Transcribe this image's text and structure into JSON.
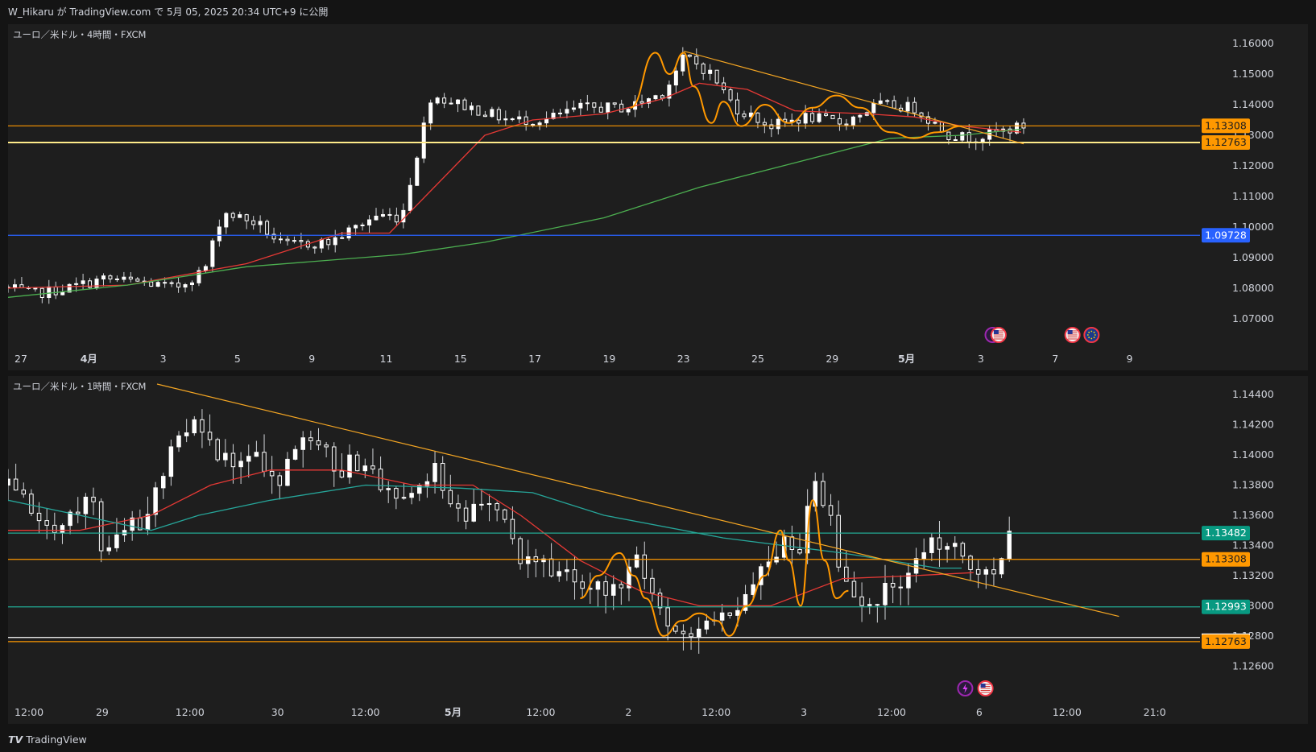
{
  "header": {
    "text": "W_Hikaru が TradingView.com で 5月 05, 2025 20:34 UTC+9 に公開"
  },
  "footer": {
    "brand": "TradingView"
  },
  "colors": {
    "bg": "#1e1e1e",
    "up": "#ffffff",
    "down": "#ffffff",
    "wick": "#cfd2d6",
    "ma_fast": "#e53935",
    "ma_slow": "#4caf50",
    "ma_teal": "#26a69a",
    "trend": "#f5a623",
    "zigzag": "#ff9800",
    "level_orange": "#ff9800",
    "level_yellow": "#ffeb8a",
    "level_blue": "#2962ff",
    "level_teal": "#22ab94",
    "label_orange": "#ff9800",
    "label_blue": "#2962ff",
    "label_teal": "#089981"
  },
  "chart_data": [
    {
      "type": "candlestick",
      "title": "ユーロ／米ドル・4時間・FXCM",
      "price_axis": {
        "ticks": [
          "1.16000",
          "1.15000",
          "1.14000",
          "1.13000",
          "1.12000",
          "1.11000",
          "1.10000",
          "1.09000",
          "1.08000",
          "1.07000"
        ],
        "ylim": [
          1.0647,
          1.1637
        ]
      },
      "time_axis": {
        "ticks": [
          "27",
          "4月",
          "3",
          "5",
          "9",
          "11",
          "15",
          "17",
          "19",
          "23",
          "25",
          "29",
          "5月",
          "3",
          "7",
          "9"
        ],
        "bold": [
          "4月",
          "5月"
        ]
      },
      "levels": [
        {
          "name": "level-1.13308",
          "value": 1.13308,
          "label": "1.13308",
          "color": "orange"
        },
        {
          "name": "level-1.12763",
          "value": 1.12763,
          "label": "1.12763",
          "color": "yellow"
        },
        {
          "name": "level-1.09728",
          "value": 1.09728,
          "label": "1.09728",
          "color": "blue"
        }
      ],
      "trendline": {
        "from": [
          0.567,
          1.1575
        ],
        "to": [
          0.852,
          1.1272
        ]
      },
      "candle_path": [
        [
          0,
          1.08
        ],
        [
          0.02,
          1.078
        ],
        [
          0.05,
          1.08
        ],
        [
          0.08,
          1.083
        ],
        [
          0.11,
          1.082
        ],
        [
          0.14,
          1.08
        ],
        [
          0.165,
          1.086
        ],
        [
          0.18,
          1.105
        ],
        [
          0.21,
          1.101
        ],
        [
          0.23,
          1.094
        ],
        [
          0.27,
          1.095
        ],
        [
          0.31,
          1.104
        ],
        [
          0.33,
          1.103
        ],
        [
          0.355,
          1.143
        ],
        [
          0.38,
          1.14
        ],
        [
          0.42,
          1.135
        ],
        [
          0.45,
          1.135
        ],
        [
          0.48,
          1.139
        ],
        [
          0.52,
          1.139
        ],
        [
          0.55,
          1.144
        ],
        [
          0.568,
          1.156
        ],
        [
          0.59,
          1.15
        ],
        [
          0.61,
          1.139
        ],
        [
          0.64,
          1.133
        ],
        [
          0.67,
          1.136
        ],
        [
          0.7,
          1.134
        ],
        [
          0.73,
          1.14
        ],
        [
          0.76,
          1.139
        ],
        [
          0.79,
          1.13
        ],
        [
          0.81,
          1.129
        ],
        [
          0.83,
          1.131
        ],
        [
          0.852,
          1.133
        ]
      ],
      "ma_fast_path": [
        [
          0,
          1.08
        ],
        [
          0.1,
          1.081
        ],
        [
          0.2,
          1.088
        ],
        [
          0.28,
          1.098
        ],
        [
          0.32,
          1.098
        ],
        [
          0.35,
          1.11
        ],
        [
          0.4,
          1.13
        ],
        [
          0.44,
          1.135
        ],
        [
          0.5,
          1.137
        ],
        [
          0.55,
          1.142
        ],
        [
          0.58,
          1.147
        ],
        [
          0.62,
          1.145
        ],
        [
          0.66,
          1.138
        ],
        [
          0.72,
          1.137
        ],
        [
          0.76,
          1.136
        ],
        [
          0.8,
          1.133
        ],
        [
          0.85,
          1.131
        ]
      ],
      "ma_slow_path": [
        [
          0,
          1.077
        ],
        [
          0.1,
          1.081
        ],
        [
          0.2,
          1.087
        ],
        [
          0.33,
          1.091
        ],
        [
          0.4,
          1.095
        ],
        [
          0.5,
          1.103
        ],
        [
          0.58,
          1.113
        ],
        [
          0.66,
          1.121
        ],
        [
          0.74,
          1.129
        ],
        [
          0.8,
          1.13
        ],
        [
          0.85,
          1.132
        ]
      ],
      "zigzag_path": [
        [
          0.522,
          1.139
        ],
        [
          0.543,
          1.157
        ],
        [
          0.555,
          1.15
        ],
        [
          0.567,
          1.157
        ],
        [
          0.575,
          1.146
        ],
        [
          0.59,
          1.134
        ],
        [
          0.6,
          1.141
        ],
        [
          0.615,
          1.133
        ],
        [
          0.635,
          1.14
        ],
        [
          0.655,
          1.134
        ],
        [
          0.675,
          1.139
        ],
        [
          0.695,
          1.143
        ],
        [
          0.715,
          1.139
        ],
        [
          0.74,
          1.131
        ],
        [
          0.76,
          1.129
        ],
        [
          0.78,
          1.131
        ],
        [
          0.8,
          1.133
        ]
      ],
      "events": [
        {
          "name": "lightning-icon",
          "x": 0.826
        },
        {
          "name": "us-flag-icon",
          "x": 0.831
        },
        {
          "name": "us-flag-icon",
          "x": 0.893
        },
        {
          "name": "eu-flag-icon",
          "x": 0.909
        }
      ]
    },
    {
      "type": "candlestick",
      "title": "ユーロ／米ドル・1時間・FXCM",
      "price_axis": {
        "ticks": [
          "1.14400",
          "1.14200",
          "1.14000",
          "1.13800",
          "1.13600",
          "1.13400",
          "1.13200",
          "1.13000",
          "1.12800",
          "1.12600"
        ],
        "ylim": [
          1.1257,
          1.1447
        ]
      },
      "time_axis": {
        "ticks": [
          "12:00",
          "29",
          "12:00",
          "30",
          "12:00",
          "5月",
          "12:00",
          "2",
          "12:00",
          "3",
          "12:00",
          "6",
          "12:00",
          "21:0"
        ],
        "bold": [
          "5月"
        ]
      },
      "levels": [
        {
          "name": "level-1.13482",
          "value": 1.13482,
          "label": "1.13482",
          "color": "teal"
        },
        {
          "name": "level-1.13308",
          "value": 1.13308,
          "label": "1.13308",
          "color": "orange"
        },
        {
          "name": "level-1.12993",
          "value": 1.12993,
          "label": "1.12993",
          "color": "teal"
        },
        {
          "name": "level-1.12790",
          "value": 1.1279,
          "label": "",
          "color": "white"
        },
        {
          "name": "level-1.12763",
          "value": 1.12763,
          "label": "1.12763",
          "color": "orange"
        }
      ],
      "trendline": {
        "from": [
          0.125,
          1.1447
        ],
        "to": [
          0.932,
          1.1293
        ]
      },
      "candle_path": [
        [
          0,
          1.138
        ],
        [
          0.03,
          1.135
        ],
        [
          0.05,
          1.136
        ],
        [
          0.07,
          1.137
        ],
        [
          0.08,
          1.133
        ],
        [
          0.1,
          1.135
        ],
        [
          0.12,
          1.136
        ],
        [
          0.13,
          1.139
        ],
        [
          0.14,
          1.142
        ],
        [
          0.155,
          1.142
        ],
        [
          0.17,
          1.141
        ],
        [
          0.19,
          1.139
        ],
        [
          0.21,
          1.14
        ],
        [
          0.23,
          1.138
        ],
        [
          0.24,
          1.141
        ],
        [
          0.26,
          1.141
        ],
        [
          0.28,
          1.139
        ],
        [
          0.3,
          1.14
        ],
        [
          0.32,
          1.137
        ],
        [
          0.34,
          1.138
        ],
        [
          0.36,
          1.139
        ],
        [
          0.37,
          1.137
        ],
        [
          0.39,
          1.136
        ],
        [
          0.41,
          1.137
        ],
        [
          0.42,
          1.134
        ],
        [
          0.44,
          1.133
        ],
        [
          0.46,
          1.132
        ],
        [
          0.49,
          1.131
        ],
        [
          0.51,
          1.131
        ],
        [
          0.53,
          1.133
        ],
        [
          0.54,
          1.131
        ],
        [
          0.555,
          1.128
        ],
        [
          0.57,
          1.128
        ],
        [
          0.59,
          1.129
        ],
        [
          0.61,
          1.13
        ],
        [
          0.625,
          1.131
        ],
        [
          0.64,
          1.133
        ],
        [
          0.655,
          1.135
        ],
        [
          0.665,
          1.133
        ],
        [
          0.675,
          1.138
        ],
        [
          0.69,
          1.136
        ],
        [
          0.7,
          1.132
        ],
        [
          0.72,
          1.13
        ],
        [
          0.74,
          1.131
        ],
        [
          0.75,
          1.132
        ],
        [
          0.77,
          1.134
        ],
        [
          0.79,
          1.134
        ],
        [
          0.81,
          1.133
        ],
        [
          0.82,
          1.132
        ],
        [
          0.84,
          1.1345
        ]
      ],
      "ma_fast_path": [
        [
          0,
          1.135
        ],
        [
          0.06,
          1.135
        ],
        [
          0.12,
          1.136
        ],
        [
          0.17,
          1.138
        ],
        [
          0.22,
          1.139
        ],
        [
          0.28,
          1.139
        ],
        [
          0.34,
          1.138
        ],
        [
          0.39,
          1.138
        ],
        [
          0.43,
          1.136
        ],
        [
          0.48,
          1.133
        ],
        [
          0.53,
          1.131
        ],
        [
          0.58,
          1.13
        ],
        [
          0.64,
          1.13
        ],
        [
          0.7,
          1.1318
        ],
        [
          0.76,
          1.132
        ],
        [
          0.81,
          1.1322
        ]
      ],
      "ma_teal_path": [
        [
          0,
          1.137
        ],
        [
          0.06,
          1.136
        ],
        [
          0.12,
          1.135
        ],
        [
          0.16,
          1.136
        ],
        [
          0.22,
          1.137
        ],
        [
          0.3,
          1.138
        ],
        [
          0.38,
          1.1378
        ],
        [
          0.44,
          1.1375
        ],
        [
          0.5,
          1.136
        ],
        [
          0.6,
          1.1345
        ],
        [
          0.7,
          1.1335
        ],
        [
          0.78,
          1.1325
        ],
        [
          0.8,
          1.1325
        ]
      ],
      "zigzag_path": [
        [
          0.48,
          1.1305
        ],
        [
          0.495,
          1.132
        ],
        [
          0.513,
          1.1335
        ],
        [
          0.525,
          1.132
        ],
        [
          0.535,
          1.1305
        ],
        [
          0.55,
          1.128
        ],
        [
          0.565,
          1.129
        ],
        [
          0.58,
          1.1295
        ],
        [
          0.595,
          1.129
        ],
        [
          0.605,
          1.128
        ],
        [
          0.62,
          1.13
        ],
        [
          0.635,
          1.132
        ],
        [
          0.648,
          1.135
        ],
        [
          0.655,
          1.133
        ],
        [
          0.665,
          1.13
        ],
        [
          0.675,
          1.137
        ],
        [
          0.685,
          1.133
        ],
        [
          0.695,
          1.1305
        ],
        [
          0.705,
          1.131
        ]
      ],
      "events": [
        {
          "name": "lightning-icon",
          "x": 0.803
        },
        {
          "name": "us-flag-icon",
          "x": 0.82
        }
      ]
    }
  ]
}
